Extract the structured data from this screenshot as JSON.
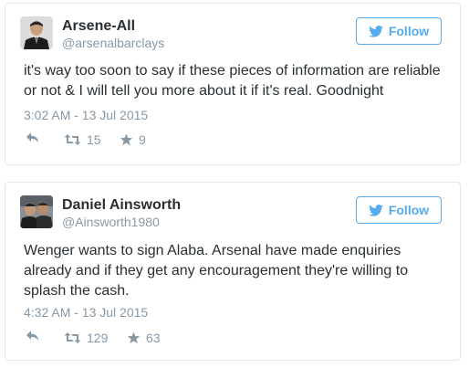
{
  "colors": {
    "accent": "#55acee",
    "text": "#292f33",
    "muted": "#8899a6",
    "border": "#e1e8ed"
  },
  "tweets": [
    {
      "name": "Arsene-All",
      "handle": "@arsenalbarclays",
      "follow_label": "Follow",
      "text": "it's way too soon to say if these pieces of information are reliable or not & I will tell you more about it if it's real. Goodnight",
      "timestamp": "3:02 AM - 13 Jul 2015",
      "retweets": "15",
      "favorites": "9",
      "icons": {
        "reply": "reply-icon",
        "retweet": "retweet-icon",
        "favorite": "star-icon",
        "follow": "twitter-bird-icon"
      }
    },
    {
      "name": "Daniel Ainsworth",
      "handle": "@Ainsworth1980",
      "follow_label": "Follow",
      "text": "Wenger wants to sign Alaba. Arsenal have made enquiries already and if they get any encouragement they're willing to splash the cash.",
      "timestamp": "4:32 AM - 13 Jul 2015",
      "retweets": "129",
      "favorites": "63",
      "icons": {
        "reply": "reply-icon",
        "retweet": "retweet-icon",
        "favorite": "star-icon",
        "follow": "twitter-bird-icon"
      }
    }
  ]
}
